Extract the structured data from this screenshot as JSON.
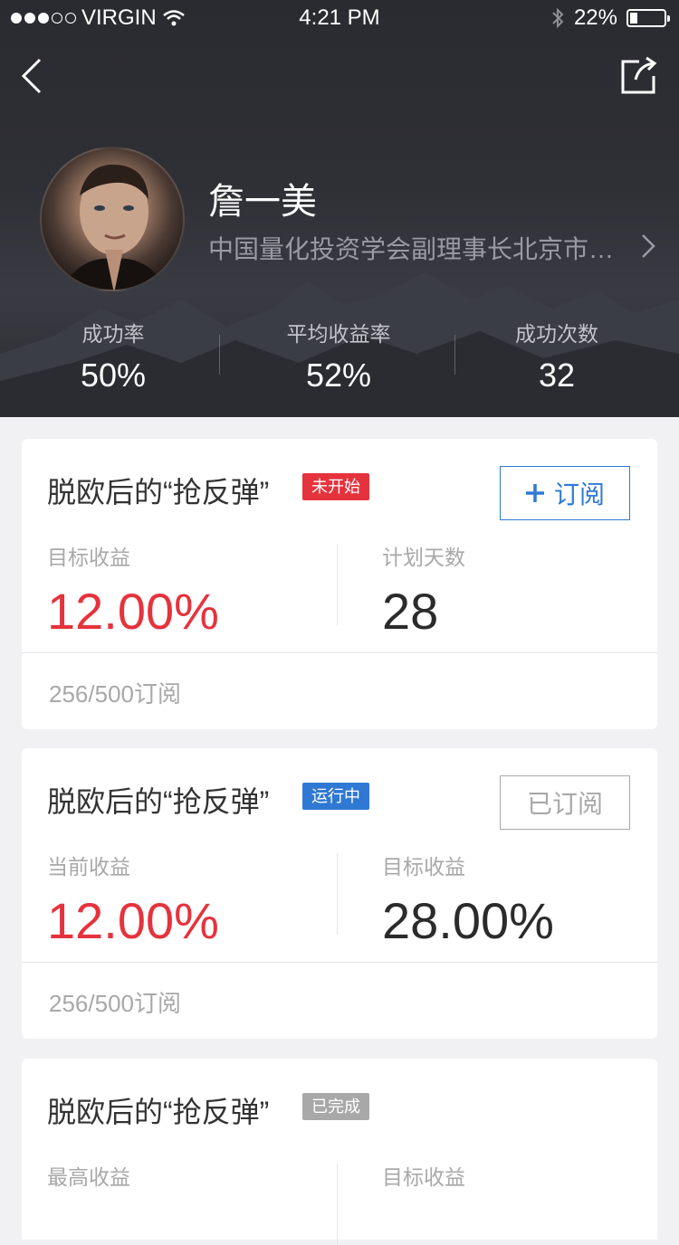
{
  "status_bar": {
    "carrier": "VIRGIN",
    "time": "4:21 PM",
    "battery": "22%",
    "battery_level": 0.22
  },
  "profile": {
    "name": "詹一美",
    "title": "中国量化投资学会副理事长北京市…"
  },
  "stats": [
    {
      "label": "成功率",
      "value": "50%"
    },
    {
      "label": "平均收益率",
      "value": "52%"
    },
    {
      "label": "成功次数",
      "value": "32"
    }
  ],
  "cards": [
    {
      "title": "脱欧后的“抢反弹”",
      "badge": "未开始",
      "badge_color": "#e5333d",
      "button": "订阅",
      "left_label": "目标收益",
      "left_value": "12.00%",
      "right_label": "计划天数",
      "right_value": "28",
      "footer": "256/500订阅"
    },
    {
      "title": "脱欧后的“抢反弹”",
      "badge": "运行中",
      "badge_color": "#2f79d4",
      "button": "已订阅",
      "left_label": "当前收益",
      "left_value": "12.00%",
      "right_label": "目标收益",
      "right_value": "28.00%",
      "footer": "256/500订阅"
    },
    {
      "title": "脱欧后的“抢反弹”",
      "badge": "已完成",
      "badge_color": "#a8a8a8",
      "left_label": "最高收益",
      "right_label": "目标收益"
    }
  ]
}
